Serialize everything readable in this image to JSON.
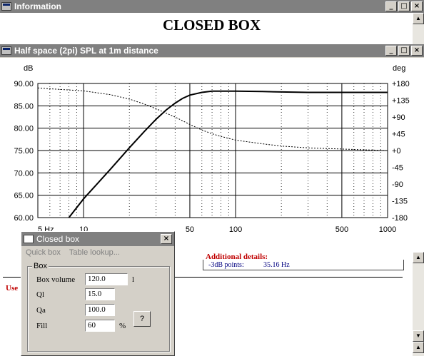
{
  "info_window": {
    "title": "Information",
    "heading": "CLOSED BOX"
  },
  "chart_window": {
    "title": "Half space (2pi) SPL at 1m distance"
  },
  "chart_data": {
    "type": "line",
    "xscale": "log",
    "xlim": [
      5,
      1000
    ],
    "ylim": [
      60,
      90
    ],
    "y2lim": [
      -180,
      180
    ],
    "ylabel": "dB",
    "y2label": "deg",
    "x_ticks": [
      "5 Hz",
      "10",
      "50",
      "100",
      "500",
      "1000"
    ],
    "x_tick_values": [
      5,
      10,
      50,
      100,
      500,
      1000
    ],
    "y_ticks": [
      "90.00",
      "85.00",
      "80.00",
      "75.00",
      "70.00",
      "65.00",
      "60.00"
    ],
    "y_tick_values": [
      90,
      85,
      80,
      75,
      70,
      65,
      60
    ],
    "y2_ticks": [
      "+180",
      "+135",
      "+90",
      "+45",
      "+0",
      "-45",
      "-90",
      "-135",
      "-180"
    ],
    "y2_tick_values": [
      180,
      135,
      90,
      45,
      0,
      -45,
      -90,
      -135,
      -180
    ],
    "grid": true,
    "series": [
      {
        "style": "solid",
        "axis": "left",
        "x": [
          8,
          10,
          15,
          20,
          25,
          30,
          35,
          40,
          45,
          50,
          60,
          70,
          80,
          100,
          150,
          200,
          300,
          500,
          700,
          1000
        ],
        "y": [
          60.0,
          64.2,
          70.8,
          75.6,
          79.2,
          82.0,
          84.1,
          85.6,
          86.7,
          87.4,
          88.0,
          88.3,
          88.3,
          88.3,
          88.2,
          88.1,
          88.0,
          88.0,
          88.0,
          88.0
        ]
      },
      {
        "style": "dotted",
        "axis": "right",
        "x": [
          5,
          10,
          15,
          20,
          25,
          30,
          40,
          50,
          60,
          70,
          80,
          100,
          150,
          200,
          300,
          500,
          700,
          1000
        ],
        "y": [
          168,
          160,
          150,
          138,
          125,
          112,
          90,
          70,
          55,
          45,
          38,
          28,
          18,
          12,
          7,
          4,
          2,
          0
        ]
      }
    ]
  },
  "details": {
    "heading": "Additional details:",
    "row_label": "-3dB points:",
    "row_value": "35.16 Hz",
    "partial_text": "Use"
  },
  "dialog": {
    "title": "Closed box",
    "menu": [
      "Quick box",
      "Table lookup..."
    ],
    "group": "Box",
    "fields": [
      {
        "label": "Box volume",
        "value": "120.0",
        "unit": "l"
      },
      {
        "label": "Ql",
        "value": "15.0",
        "unit": ""
      },
      {
        "label": "Qa",
        "value": "100.0",
        "unit": ""
      },
      {
        "label": "Fill",
        "value": "60",
        "unit": "%"
      }
    ],
    "help_button": "?"
  }
}
